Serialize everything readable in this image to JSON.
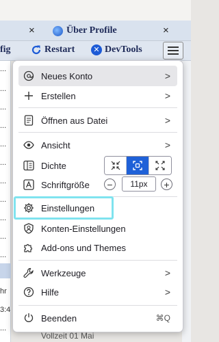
{
  "tab": {
    "title": "Über Profile",
    "close": "×"
  },
  "toolbar": {
    "cut_label": "fig",
    "restart_label": "Restart",
    "devtools_label": "DevTools",
    "devtools_icon_glyph": "✕"
  },
  "left_column": [
    "...",
    "...",
    "...",
    "...",
    "...",
    "...",
    "...",
    "...",
    "...",
    "...",
    "...",
    "hr",
    "3:4",
    "..."
  ],
  "bottom_text": "Vollzeit 01 Mai",
  "menu": {
    "new_account": "Neues Konto",
    "create": "Erstellen",
    "open_file": "Öffnen aus Datei",
    "view": "Ansicht",
    "density": "Dichte",
    "font_size": "Schriftgröße",
    "font_size_value": "11px",
    "minus": "−",
    "plus": "+",
    "settings": "Einstellungen",
    "account_settings": "Konten-Einstellungen",
    "addons": "Add-ons und Themes",
    "tools": "Werkzeuge",
    "help": "Hilfe",
    "quit": "Beenden",
    "quit_shortcut": "⌘Q",
    "chevron": ">"
  },
  "colors": {
    "accent": "#1f61d8",
    "focus_ring": "#7fe3ef",
    "hover": "#e6e6e9"
  }
}
